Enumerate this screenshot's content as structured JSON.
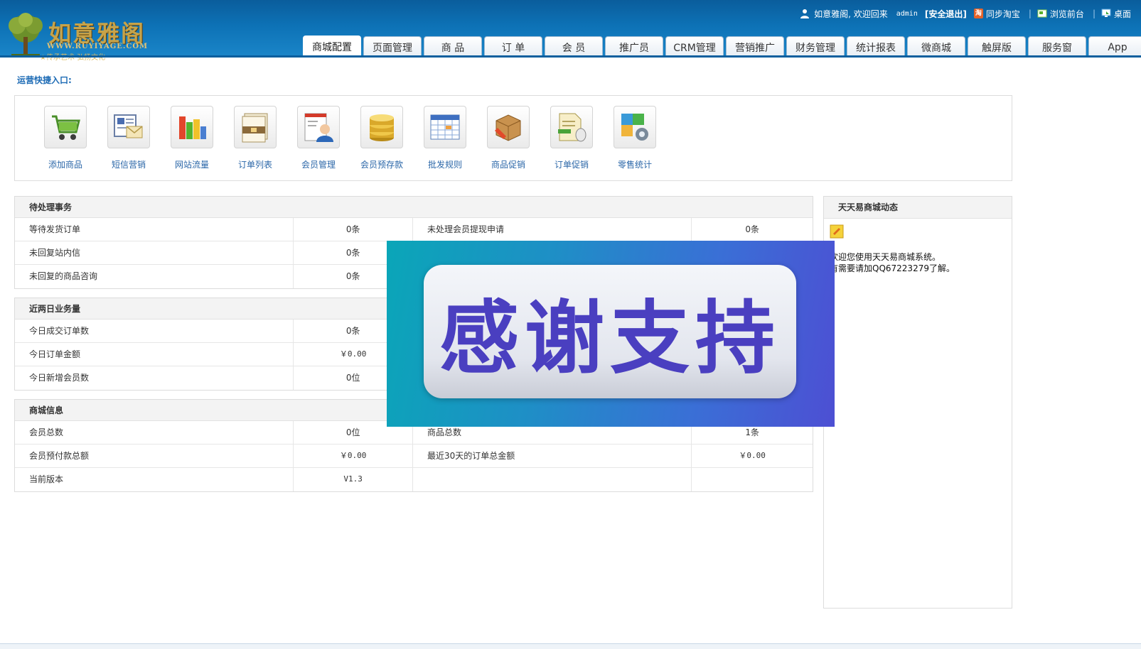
{
  "header": {
    "brand": "如意雅阁",
    "url": "WWW.RUYIYAGE.COM",
    "slogan": "★传承艺术 弘扬文化",
    "topbar": {
      "welcome": "如意雅阁, 欢迎回来",
      "username": "admin",
      "logout": "[安全退出]",
      "taobao_badge": "淘",
      "sync_taobao": "同步淘宝",
      "separator": "|",
      "browse_front": "浏览前台",
      "desktop": "桌面"
    },
    "tabs": [
      {
        "label": "商城配置",
        "active": true
      },
      {
        "label": "页面管理"
      },
      {
        "label": "商 品"
      },
      {
        "label": "订 单"
      },
      {
        "label": "会 员"
      },
      {
        "label": "推广员"
      },
      {
        "label": "CRM管理"
      },
      {
        "label": "营销推广"
      },
      {
        "label": "财务管理"
      },
      {
        "label": "统计报表"
      },
      {
        "label": "微商城"
      },
      {
        "label": "触屏版"
      },
      {
        "label": "服务窗"
      },
      {
        "label": "App"
      }
    ]
  },
  "quick": {
    "title": "运营快捷入口:",
    "items": [
      {
        "label": "添加商品",
        "icon": "shopping-cart-icon"
      },
      {
        "label": "短信营销",
        "icon": "sms-icon"
      },
      {
        "label": "网站流量",
        "icon": "bar-chart-icon"
      },
      {
        "label": "订单列表",
        "icon": "order-list-icon"
      },
      {
        "label": "会员管理",
        "icon": "member-icon"
      },
      {
        "label": "会员预存款",
        "icon": "coins-icon"
      },
      {
        "label": "批发规则",
        "icon": "calendar-table-icon"
      },
      {
        "label": "商品促销",
        "icon": "package-icon"
      },
      {
        "label": "订单促销",
        "icon": "order-promo-icon"
      },
      {
        "label": "零售统计",
        "icon": "puzzle-gear-icon"
      }
    ]
  },
  "pending": {
    "title": "待处理事务",
    "rows": [
      [
        "等待发货订单",
        "0条",
        "未处理会员提现申请",
        "0条"
      ],
      [
        "未回复站内信",
        "0条",
        "",
        ""
      ],
      [
        "未回复的商品咨询",
        "0条",
        "",
        ""
      ]
    ]
  },
  "recent": {
    "title": "近两日业务量",
    "rows": [
      [
        "今日成交订单数",
        "0条",
        "",
        ""
      ],
      [
        "今日订单金额",
        "￥0.00",
        "",
        ""
      ],
      [
        "今日新增会员数",
        "0位",
        "",
        ""
      ]
    ]
  },
  "shop": {
    "title": "商城信息",
    "rows": [
      [
        "会员总数",
        "0位",
        "商品总数",
        "1条"
      ],
      [
        "会员预付款总额",
        "￥0.00",
        "最近30天的订单总金额",
        "￥0.00"
      ],
      [
        "当前版本",
        "V1.3",
        "",
        ""
      ]
    ]
  },
  "news": {
    "title": "天天易商城动态",
    "lines": [
      "欢迎您使用天天易商城系统。",
      "有需要请加QQ67223279了解。"
    ]
  },
  "banner": {
    "text": "感谢支持"
  },
  "colors": {
    "header": "#0d72b6",
    "link": "#2b67a8",
    "banner_text": "#4a3fc0"
  }
}
